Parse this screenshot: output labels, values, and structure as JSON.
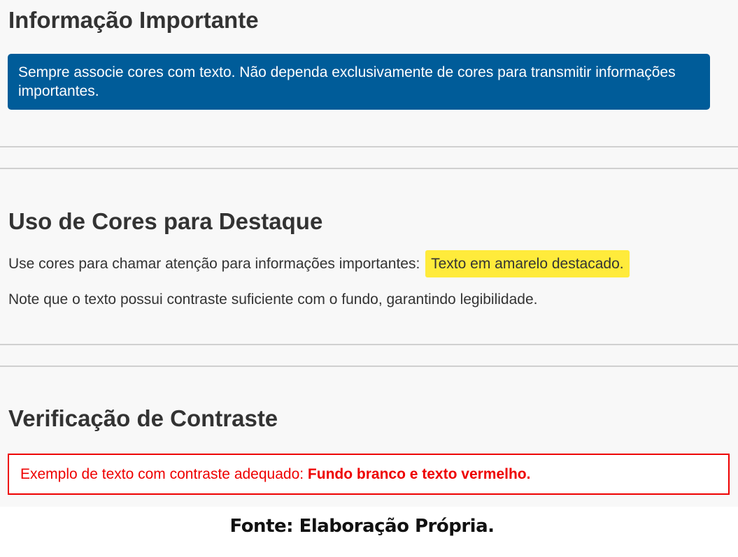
{
  "sections": {
    "info": {
      "title": "Informação Importante",
      "message": "Sempre associe cores com texto. Não dependa exclusivamente de cores para transmitir informações importantes."
    },
    "colors": {
      "title": "Uso de Cores para Destaque",
      "use_text": "Use cores para chamar atenção para informações importantes: ",
      "highlight_text": "Texto em amarelo destacado.",
      "note_text": "Note que o texto possui contraste suficiente com o fundo, garantindo legibilidade."
    },
    "contrast": {
      "title": "Verificação de Contraste",
      "example_text": "Exemplo de texto com contraste adequado: ",
      "example_bold": "Fundo branco e texto vermelho."
    }
  },
  "caption": "Fonte: Elaboração Própria.",
  "colors": {
    "page_background": "#f8f8f8",
    "info_box": "#005c99",
    "highlight": "#ffeb3b",
    "contrast_red": "#ee0000",
    "divider": "#d0d0d0"
  }
}
